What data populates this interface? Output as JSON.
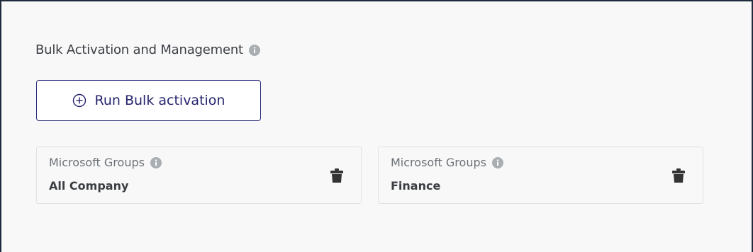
{
  "section": {
    "title": "Bulk Activation and Management",
    "info_icon": "info-icon"
  },
  "run_button": {
    "label": "Run Bulk activation",
    "icon": "circle-plus-icon",
    "color": "#25246e"
  },
  "groups": [
    {
      "label": "Microsoft Groups",
      "value": "All Company",
      "delete_icon": "trash-icon"
    },
    {
      "label": "Microsoft Groups",
      "value": "Finance",
      "delete_icon": "trash-icon"
    }
  ]
}
